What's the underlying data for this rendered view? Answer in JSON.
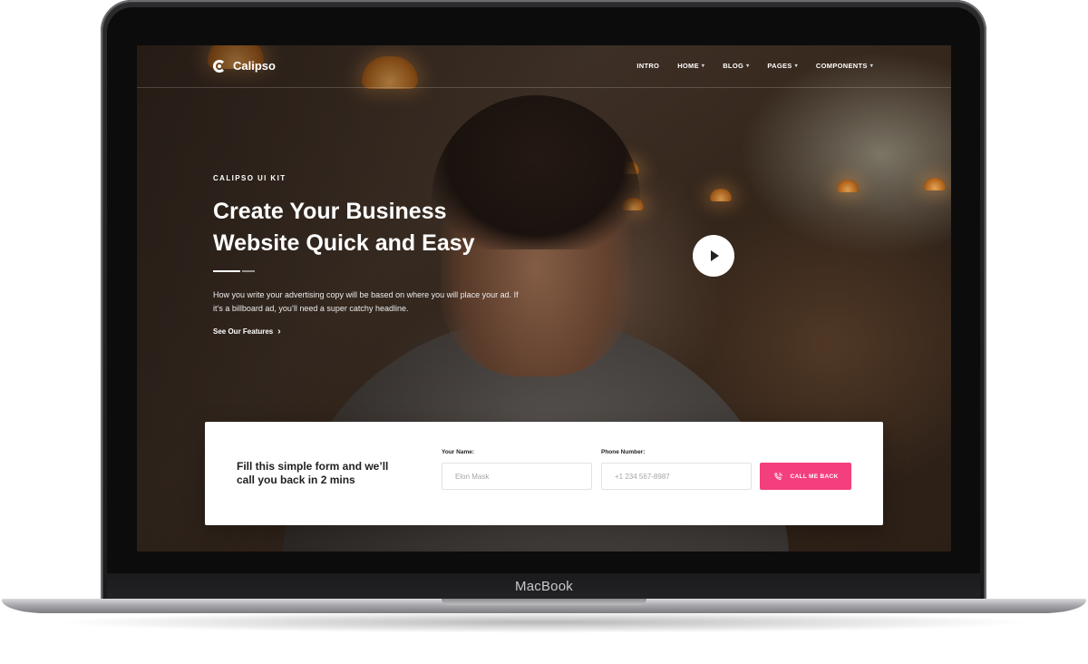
{
  "device": {
    "brand_label": "MacBook"
  },
  "nav": {
    "logo_text": "Calipso",
    "items": [
      {
        "label": "INTRO",
        "has_dropdown": false
      },
      {
        "label": "HOME",
        "has_dropdown": true
      },
      {
        "label": "BLOG",
        "has_dropdown": true
      },
      {
        "label": "PAGES",
        "has_dropdown": true
      },
      {
        "label": "COMPONENTS",
        "has_dropdown": true
      }
    ],
    "dropdown_icon": "chevron-down-icon"
  },
  "hero": {
    "eyebrow": "CALIPSO UI KIT",
    "title_line1": "Create Your Business",
    "title_line2": "Website Quick and Easy",
    "description_line1": "How you write your advertising copy will be based on where you will place your ad. If",
    "description_line2": "it’s a billboard ad, you’ll need a super catchy headline.",
    "link_label": "See Our Features",
    "link_icon": "chevron-right-icon",
    "play_icon": "play-icon"
  },
  "callback_form": {
    "heading_line1": "Fill this simple form and we’ll",
    "heading_line2": "call you back in 2 mins",
    "name_label": "Your Name:",
    "name_placeholder": "Elon Mask",
    "phone_label": "Phone Number:",
    "phone_placeholder": "+1 234 567-8987",
    "button_label": "CALL ME BACK",
    "button_icon": "phone-icon"
  },
  "colors": {
    "accent": "#f43f7e",
    "text_dark": "#1f1f1f",
    "text_light": "#ffffff"
  }
}
